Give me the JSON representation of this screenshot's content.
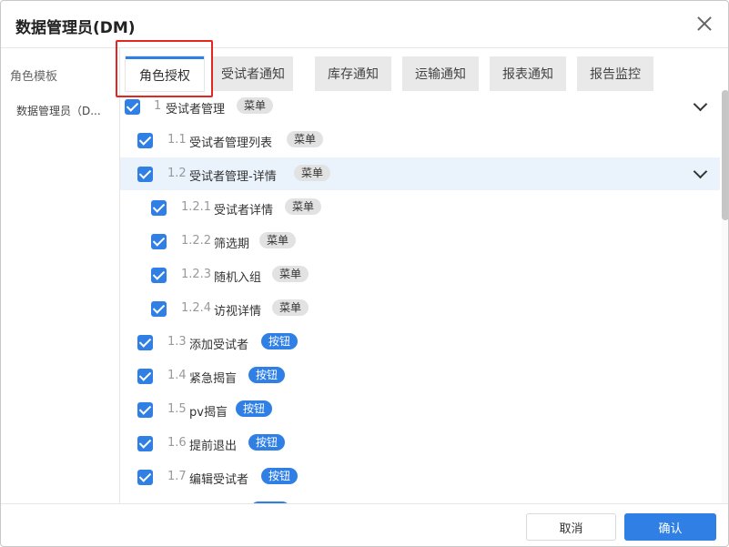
{
  "dialog": {
    "title": "数据管理员(DM)"
  },
  "sidebar": {
    "title": "角色模板",
    "items": [
      {
        "label": "数据管理员（D..."
      }
    ]
  },
  "tabs": [
    {
      "label": "角色授权",
      "active": true
    },
    {
      "label": "受试者通知",
      "active": false
    },
    {
      "label": "库存通知",
      "active": false
    },
    {
      "label": "运输通知",
      "active": false
    },
    {
      "label": "报表通知",
      "active": false
    },
    {
      "label": "报告监控",
      "active": false
    }
  ],
  "tree": {
    "rows": [
      {
        "num": "1",
        "label": "受试者管理",
        "tag": "菜单",
        "tag_type": "menu",
        "level": 0,
        "checked": true,
        "expanded": true
      },
      {
        "num": "1.1",
        "label": "受试者管理列表",
        "tag": "菜单",
        "tag_type": "menu",
        "level": 1,
        "checked": true
      },
      {
        "num": "1.2",
        "label": "受试者管理-详情",
        "tag": "菜单",
        "tag_type": "menu",
        "level": 1,
        "checked": true,
        "expanded": true,
        "highlighted": true
      },
      {
        "num": "1.2.1",
        "label": "受试者详情",
        "tag": "菜单",
        "tag_type": "menu",
        "level": 2,
        "checked": true
      },
      {
        "num": "1.2.2",
        "label": "筛选期",
        "tag": "菜单",
        "tag_type": "menu",
        "level": 2,
        "checked": true
      },
      {
        "num": "1.2.3",
        "label": "随机入组",
        "tag": "菜单",
        "tag_type": "menu",
        "level": 2,
        "checked": true
      },
      {
        "num": "1.2.4",
        "label": "访视详情",
        "tag": "菜单",
        "tag_type": "menu",
        "level": 2,
        "checked": true
      },
      {
        "num": "1.3",
        "label": "添加受试者",
        "tag": "按钮",
        "tag_type": "button",
        "level": 1,
        "checked": true
      },
      {
        "num": "1.4",
        "label": "紧急揭盲",
        "tag": "按钮",
        "tag_type": "button",
        "level": 1,
        "checked": true
      },
      {
        "num": "1.5",
        "label": "pv揭盲",
        "tag": "按钮",
        "tag_type": "button",
        "level": 1,
        "checked": true
      },
      {
        "num": "1.6",
        "label": "提前退出",
        "tag": "按钮",
        "tag_type": "button",
        "level": 1,
        "checked": true
      },
      {
        "num": "1.7",
        "label": "编辑受试者",
        "tag": "按钮",
        "tag_type": "button",
        "level": 1,
        "checked": true
      }
    ]
  },
  "footer": {
    "cancel_label": "取消",
    "confirm_label": "确认"
  },
  "colors": {
    "accent": "#2f7fe5",
    "highlight_row": "#eaf3fc",
    "menu_tag_bg": "#e2e2e2",
    "annotation_red": "#e52520"
  }
}
